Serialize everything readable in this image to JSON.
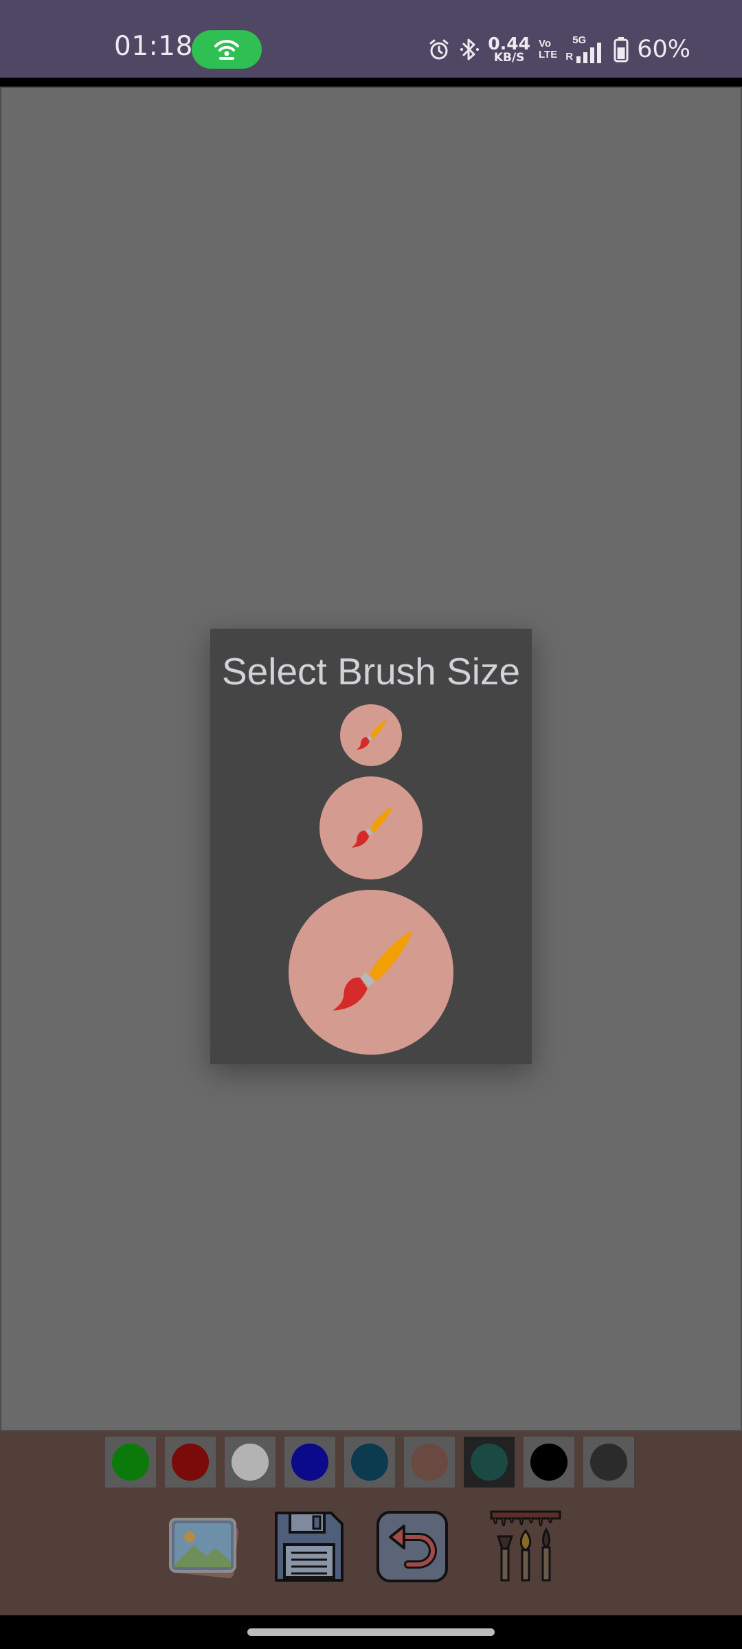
{
  "status_bar": {
    "time": "01:18",
    "net_speed_value": "0.44",
    "net_speed_unit": "KB/S",
    "volte_top": "Vo",
    "volte_bottom": "LTE",
    "network_type": "5G",
    "sim_label": "R",
    "battery_percent": "60%",
    "icons": [
      "hotspot-icon",
      "alarm-icon",
      "bluetooth-icon",
      "signal-icon",
      "battery-icon"
    ]
  },
  "dialog": {
    "title": "Select Brush Size",
    "options": [
      {
        "name": "small",
        "icon": "paintbrush-icon"
      },
      {
        "name": "medium",
        "icon": "paintbrush-icon"
      },
      {
        "name": "large",
        "icon": "paintbrush-icon"
      }
    ]
  },
  "palette": {
    "colors": [
      "#0b7a0b",
      "#7a0b0b",
      "#b3b3b3",
      "#0a0a8a",
      "#0c3a4e",
      "#6a4a40",
      "#1a4a43",
      "#000000",
      "#2b2b2b"
    ],
    "selected_index": 6
  },
  "toolbar": {
    "tools": [
      "gallery-icon",
      "save-disk-icon",
      "undo-icon",
      "brush-set-icon"
    ]
  }
}
